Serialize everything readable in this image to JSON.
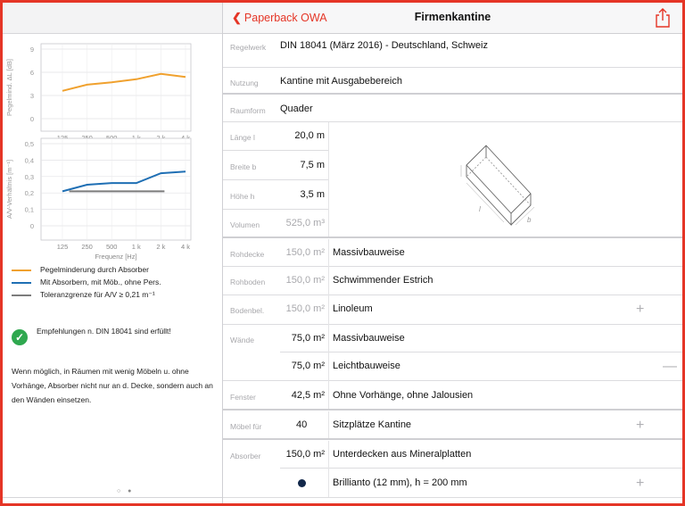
{
  "nav": {
    "back_label": "Paperback OWA",
    "title": "Firmenkantine"
  },
  "sidebar": {
    "chart1": {
      "ylabel": "Pegelmind. ΔL [dB]",
      "yticks": [
        "9",
        "6",
        "3",
        "0"
      ],
      "xticks": [
        "125",
        "250",
        "500",
        "1 k",
        "2 k",
        "4 k"
      ]
    },
    "chart2": {
      "ylabel": "A/V-Verhältnis [m⁻¹]",
      "yticks": [
        "0,5",
        "0,4",
        "0,3",
        "0,2",
        "0,1",
        "0"
      ],
      "xticks": [
        "125",
        "250",
        "500",
        "1 k",
        "2 k",
        "4 k"
      ],
      "xlabel": "Frequenz [Hz]"
    },
    "legend": [
      {
        "label": "Pegelminderung durch Absorber",
        "color": "#f0a12e"
      },
      {
        "label": "Mit Absorbern, mit Möb., ohne Pers.",
        "color": "#1f6fb4"
      },
      {
        "label": "Toleranzgrenze für A/V ≥ 0,21 m⁻¹",
        "color": "#7c7c7c"
      }
    ],
    "status_text": "Empfehlungen n. DIN 18041 sind erfüllt!",
    "advice_text": "Wenn möglich, in Räumen mit wenig Möbeln u. ohne Vorhänge, Absorber nicht nur an d. Decke, sondern auch an den Wänden einsetzen.",
    "page_dots": "○ ●"
  },
  "chart_data": [
    {
      "type": "line",
      "ylabel": "Pegelmind. ΔL [dB]",
      "categories": [
        "125",
        "250",
        "500",
        "1 k",
        "2 k",
        "4 k"
      ],
      "ylim": [
        0,
        9
      ],
      "series": [
        {
          "name": "Pegelminderung durch Absorber",
          "values": [
            3.6,
            4.4,
            4.7,
            5.1,
            5.8,
            5.4
          ]
        }
      ]
    },
    {
      "type": "line",
      "ylabel": "A/V-Verhältnis [m⁻¹]",
      "xlabel": "Frequenz [Hz]",
      "categories": [
        "125",
        "250",
        "500",
        "1 k",
        "2 k",
        "4 k"
      ],
      "ylim": [
        0,
        0.5
      ],
      "series": [
        {
          "name": "Mit Absorbern, mit Möb., ohne Pers.",
          "values": [
            0.21,
            0.25,
            0.26,
            0.26,
            0.32,
            0.33
          ]
        },
        {
          "name": "Toleranzgrenze für A/V ≥ 0,21 m⁻¹",
          "x_range": [
            "250",
            "2 k"
          ],
          "values": [
            0.21,
            0.21
          ]
        }
      ]
    }
  ],
  "form": {
    "regelwerk": {
      "label": "Regelwerk",
      "value": "DIN 18041 (März 2016) - Deutschland, Schweiz"
    },
    "nutzung": {
      "label": "Nutzung",
      "value": "Kantine mit Ausgabebereich"
    },
    "raumform": {
      "label": "Raumform",
      "value": "Quader"
    },
    "laenge": {
      "label": "Länge l",
      "value": "20,0 m"
    },
    "breite": {
      "label": "Breite b",
      "value": "7,5 m"
    },
    "hoehe": {
      "label": "Höhe h",
      "value": "3,5 m"
    },
    "volumen": {
      "label": "Volumen",
      "value": "525,0 m³"
    },
    "diagram_labels": {
      "h": "h",
      "l": "l",
      "b": "b"
    },
    "rohdecke": {
      "label": "Rohdecke",
      "area": "150,0 m²",
      "type": "Massivbauweise"
    },
    "rohboden": {
      "label": "Rohboden",
      "area": "150,0 m²",
      "type": "Schwimmender Estrich"
    },
    "bodenbel": {
      "label": "Bodenbel.",
      "area": "150,0 m²",
      "type": "Linoleum"
    },
    "waende": {
      "label": "Wände",
      "area": "75,0 m²",
      "type": "Massivbauweise"
    },
    "waende2": {
      "area": "75,0 m²",
      "type": "Leichtbauweise"
    },
    "fenster": {
      "label": "Fenster",
      "area": "42,5 m²",
      "type": "Ohne Vorhänge, ohne Jalousien"
    },
    "moebel": {
      "label": "Möbel für",
      "count": "40",
      "type": "Sitzplätze Kantine"
    },
    "absorber": {
      "label": "Absorber",
      "area": "150,0 m²",
      "type": "Unterdecken aus Mineralplatten"
    },
    "absorber2": {
      "type": "Brillianto (12 mm), h = 200 mm"
    },
    "plus_glyph": "+",
    "minus_glyph": "—"
  }
}
